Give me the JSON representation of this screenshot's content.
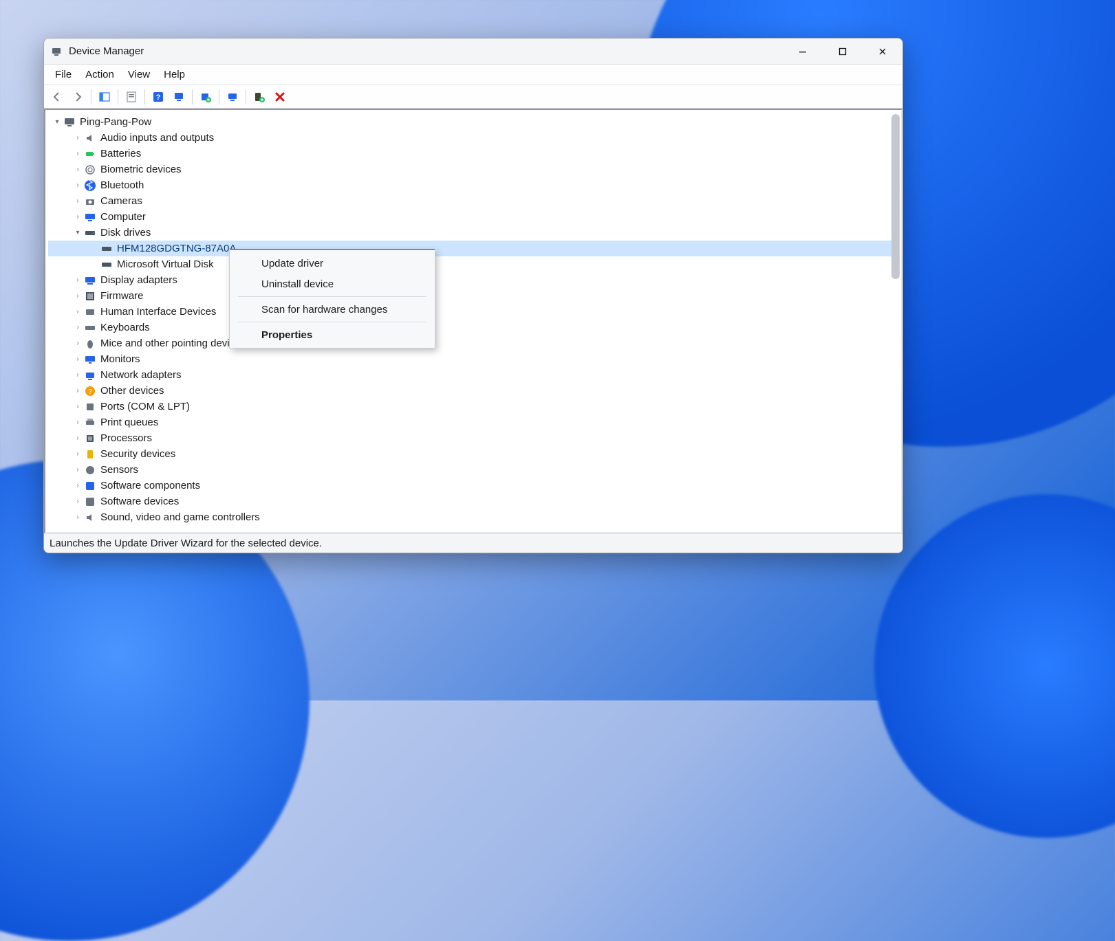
{
  "window": {
    "title": "Device Manager"
  },
  "menu": {
    "file": "File",
    "action": "Action",
    "view": "View",
    "help": "Help"
  },
  "tree": {
    "root": "Ping-Pang-Pow",
    "categories": [
      "Audio inputs and outputs",
      "Batteries",
      "Biometric devices",
      "Bluetooth",
      "Cameras",
      "Computer",
      "Disk drives",
      "Display adapters",
      "Firmware",
      "Human Interface Devices",
      "Keyboards",
      "Mice and other pointing devices",
      "Monitors",
      "Network adapters",
      "Other devices",
      "Ports (COM & LPT)",
      "Print queues",
      "Processors",
      "Security devices",
      "Sensors",
      "Software components",
      "Software devices",
      "Sound, video and game controllers"
    ],
    "disk_children": [
      "HFM128GDGTNG-87A0A",
      "Microsoft Virtual Disk"
    ]
  },
  "context_menu": {
    "update": "Update driver",
    "uninstall": "Uninstall device",
    "scan": "Scan for hardware changes",
    "properties": "Properties"
  },
  "status": "Launches the Update Driver Wizard for the selected device."
}
